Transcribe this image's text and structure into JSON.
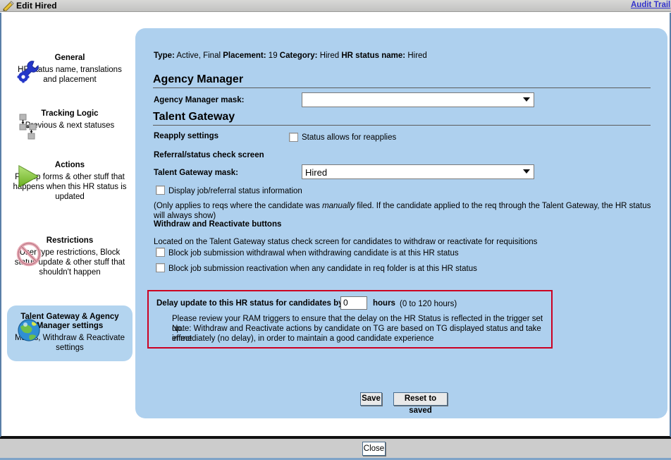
{
  "titlebar": {
    "icon": "pencil-icon",
    "title": "Edit Hired",
    "audit_link": "Audit Trail"
  },
  "sidebar": {
    "items": [
      {
        "icon": "wrench-gear-icon",
        "title": "General",
        "desc": "HR status name, translations and placement",
        "selected": false
      },
      {
        "icon": "flowchart-icon",
        "title": "Tracking Logic",
        "desc": "Previous & next statuses",
        "selected": false
      },
      {
        "icon": "green-play-triangle-icon",
        "title": "Actions",
        "desc": "Pop up forms & other stuff that happens when this HR status is updated",
        "selected": false
      },
      {
        "icon": "no-entry-icon",
        "title": "Restrictions",
        "desc": "User type restrictions, Block status update & other stuff that shouldn't happen",
        "selected": false
      },
      {
        "icon": "globe-icon",
        "title": "Talent Gateway & Agency Manager settings",
        "desc": "Masks, Withdraw & Reactivate settings",
        "selected": true
      }
    ]
  },
  "main": {
    "meta": {
      "type_label": "Type:",
      "type_value": "Active, Final",
      "placement_label": "Placement:",
      "placement_value": "19",
      "category_label": "Category:",
      "category_value": "Hired",
      "hr_status_label": "HR status name:",
      "hr_status_value": "Hired"
    },
    "agency_manager": {
      "heading": "Agency Manager",
      "mask_label": "Agency Manager mask:",
      "mask_value": ""
    },
    "talent_gateway": {
      "heading": "Talent Gateway",
      "reapply_label": "Reapply settings",
      "reapply_checkbox_label": "Status allows for reapplies",
      "reapply_checked": false,
      "referral_label": "Referral/status check screen",
      "tg_mask_label": "Talent Gateway mask:",
      "tg_mask_value": "Hired",
      "display_status_label": "Display job/referral status information",
      "display_status_checked": false,
      "display_status_note_1": "(Only applies to reqs where the candidate was ",
      "display_status_note_italic": "manually",
      "display_status_note_2": " filed. If the candidate applied to the req through the Talent Gateway, the HR status will",
      "display_status_note_3": "always show)",
      "withdraw_heading": "Withdraw and Reactivate buttons",
      "withdraw_desc": "Located on the Talent Gateway status check screen for candidates to withdraw or reactivate for requisitions",
      "block_withdrawal_label": "Block job submission withdrawal when withdrawing candidate is at this HR status",
      "block_withdrawal_checked": false,
      "block_reactivation_label": "Block job submission reactivation when any candidate in req folder is at this HR status",
      "block_reactivation_checked": false
    },
    "delay_box": {
      "border_color": "#cc0022",
      "label_prefix": "Delay update to this HR status for candidates by",
      "value": "0",
      "units_bold": "hours",
      "units_range": "(0 to 120 hours)",
      "note_line_1": "Please review your RAM triggers to ensure that the delay on the HR Status is reflected in the trigger set up.",
      "note_line_2": "Note: Withdraw and Reactivate actions by candidate on TG are based on TG displayed status and take effect",
      "note_line_3": "immediately (no delay), in order to maintain a good candidate experience"
    },
    "buttons": {
      "save": "Save",
      "reset": "Reset to saved"
    }
  },
  "footer": {
    "close": "Close"
  }
}
